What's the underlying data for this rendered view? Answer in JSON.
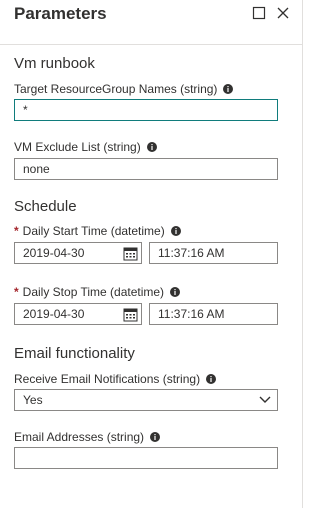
{
  "header": {
    "title": "Parameters"
  },
  "sections": {
    "vm_runbook": "Vm runbook",
    "schedule": "Schedule",
    "email": "Email functionality"
  },
  "fields": {
    "target_rg": {
      "label": "Target ResourceGroup Names (string)",
      "value": "*"
    },
    "vm_exclude": {
      "label": "VM Exclude List (string)",
      "value": "none"
    },
    "start_time": {
      "label": "Daily Start Time (datetime)",
      "date": "2019-04-30",
      "time": "11:37:16 AM"
    },
    "stop_time": {
      "label": "Daily Stop Time (datetime)",
      "date": "2019-04-30",
      "time": "11:37:16 AM"
    },
    "email_notify": {
      "label": "Receive Email Notifications (string)",
      "selected": "Yes"
    },
    "email_addresses": {
      "label": "Email Addresses (string)",
      "value": ""
    }
  },
  "required_marker": "*",
  "icons": {
    "maximize": "maximize-icon",
    "close": "close-icon",
    "info": "info-icon",
    "calendar": "calendar-icon",
    "dropdown": "chevron-down-icon"
  },
  "colors": {
    "focus_border": "#107c7c",
    "required": "#a4262c",
    "border": "#8a8886"
  }
}
